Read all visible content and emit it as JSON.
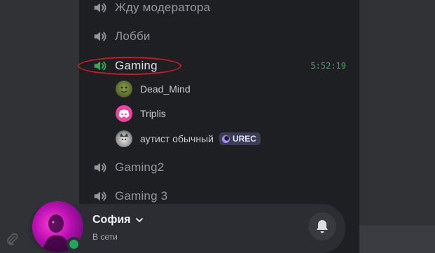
{
  "channels": [
    {
      "name": "Жду модератора",
      "active": false
    },
    {
      "name": "Лобби",
      "active": false
    },
    {
      "name": "Gaming",
      "active": true,
      "timer": "5:52:19"
    },
    {
      "name": "Gaming2",
      "active": false
    },
    {
      "name": "Gaming 3",
      "active": false
    }
  ],
  "members": [
    {
      "name": "Dead_Mind",
      "avatar_icon": "shrek-avatar-icon"
    },
    {
      "name": "Triplis",
      "avatar_icon": "discord-logo-icon"
    },
    {
      "name": "аутист обычный",
      "avatar_icon": "cat-avatar-icon",
      "badge": "UREC"
    }
  ],
  "user": {
    "name": "София",
    "status": "В сети"
  },
  "colors": {
    "accent_green": "#3ba55c",
    "online": "#23a55a",
    "highlight_ring": "#c81d25",
    "discord_pink": "#eb459e"
  }
}
